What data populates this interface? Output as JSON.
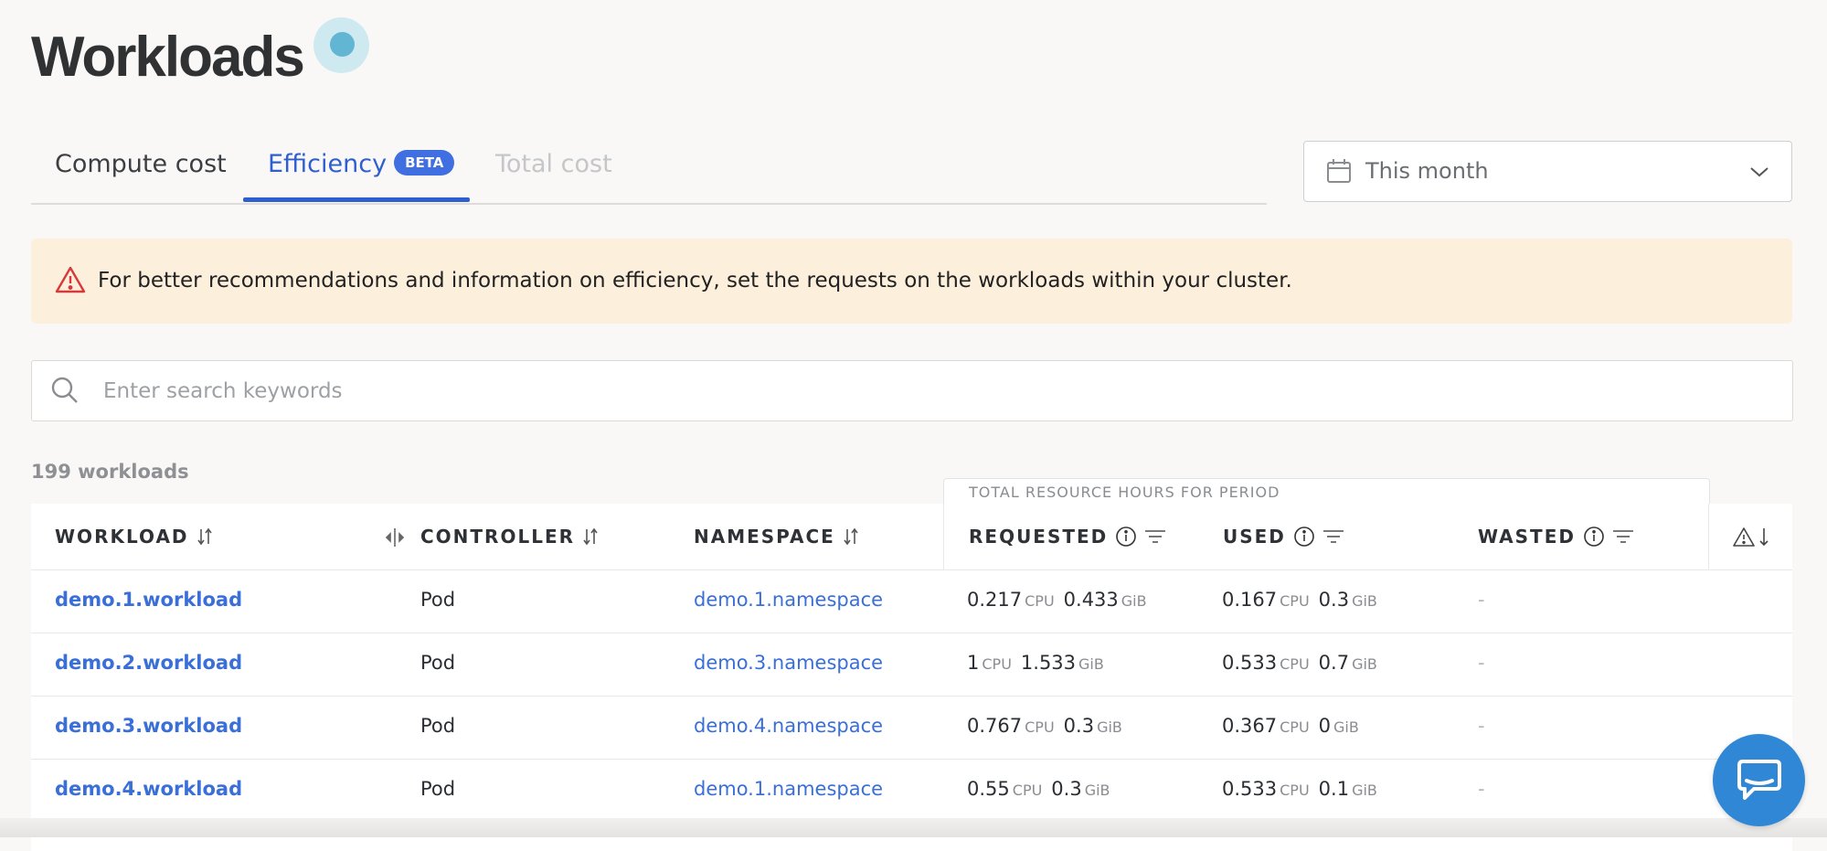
{
  "app": {
    "title": "Workloads"
  },
  "tabs": [
    {
      "label": "Compute cost",
      "state": "inactive"
    },
    {
      "label": "Efficiency",
      "badge": "BETA",
      "state": "active"
    },
    {
      "label": "Total cost",
      "state": "disabled"
    }
  ],
  "date_range": {
    "value": "This month",
    "icon": "calendar-icon"
  },
  "alert": {
    "icon": "warning-triangle-icon",
    "text": "For better recommendations and information on efficiency, set the requests on the workloads within your cluster."
  },
  "search": {
    "placeholder": "Enter search keywords",
    "value": ""
  },
  "summary": {
    "count_label": "199 workloads"
  },
  "table": {
    "group_header": "TOTAL RESOURCE HOURS FOR PERIOD",
    "columns": {
      "workload": "WORKLOAD",
      "controller": "CONTROLLER",
      "namespace": "NAMESPACE",
      "requested": "REQUESTED",
      "used": "USED",
      "wasted": "WASTED"
    },
    "units": {
      "cpu": "CPU",
      "mem": "GiB"
    },
    "rows": [
      {
        "workload": "demo.1.workload",
        "controller": "Pod",
        "namespace": "demo.1.namespace",
        "req_cpu": "0.217",
        "req_mem": "0.433",
        "used_cpu": "0.167",
        "used_mem": "0.3",
        "wasted": "-"
      },
      {
        "workload": "demo.2.workload",
        "controller": "Pod",
        "namespace": "demo.3.namespace",
        "req_cpu": "1",
        "req_mem": "1.533",
        "used_cpu": "0.533",
        "used_mem": "0.7",
        "wasted": "-"
      },
      {
        "workload": "demo.3.workload",
        "controller": "Pod",
        "namespace": "demo.4.namespace",
        "req_cpu": "0.767",
        "req_mem": "0.3",
        "used_cpu": "0.367",
        "used_mem": "0",
        "wasted": "-"
      },
      {
        "workload": "demo.4.workload",
        "controller": "Pod",
        "namespace": "demo.1.namespace",
        "req_cpu": "0.55",
        "req_mem": "0.3",
        "used_cpu": "0.533",
        "used_mem": "0.1",
        "wasted": "-"
      }
    ]
  },
  "colors": {
    "accent": "#2f5fcf",
    "link": "#3a6fd8",
    "alert_bg": "#fcefdc",
    "warning": "#d6393a",
    "chat": "#2f87d6"
  }
}
